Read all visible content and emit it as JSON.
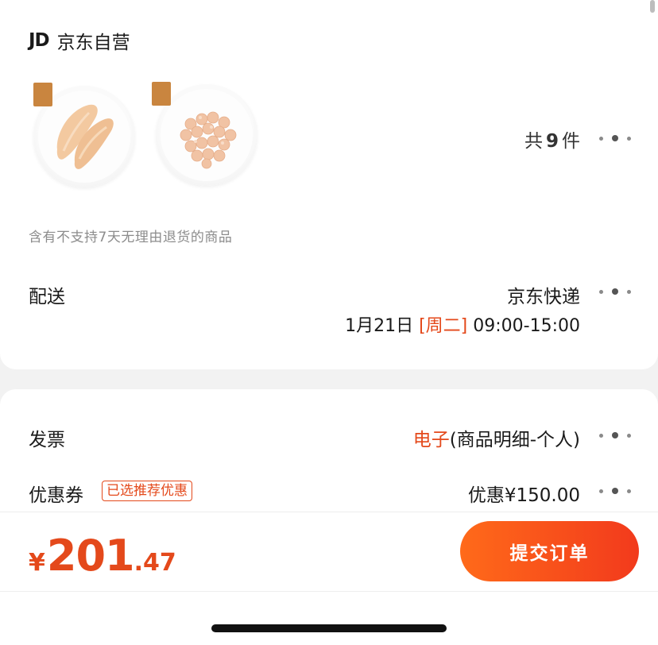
{
  "store": {
    "logo": "JD",
    "name": "京东自营"
  },
  "products": [
    {
      "name": "chicken-breast-image",
      "tag": ""
    },
    {
      "name": "chicken-pieces-image",
      "tag": ""
    }
  ],
  "items_count": {
    "prefix": "共",
    "number": "9",
    "suffix": "件"
  },
  "return_note": "含有不支持7天无理由退货的商品",
  "delivery": {
    "label": "配送",
    "carrier": "京东快递",
    "date": "1月21日",
    "weekday": "[周二]",
    "time": "09:00-15:00"
  },
  "invoice": {
    "label": "发票",
    "type": "电子",
    "detail": "(商品明细-个人)"
  },
  "coupon": {
    "label": "优惠券",
    "badge": "已选推荐优惠",
    "value": "优惠¥150.00"
  },
  "total": {
    "currency": "¥",
    "integer": "201",
    "decimal": ".47"
  },
  "submit_label": "提交订单",
  "colors": {
    "accent": "#e4491b",
    "button_start": "#ff6a1a",
    "button_end": "#f23a1c"
  },
  "icons": {
    "more": "more-dots-icon"
  }
}
